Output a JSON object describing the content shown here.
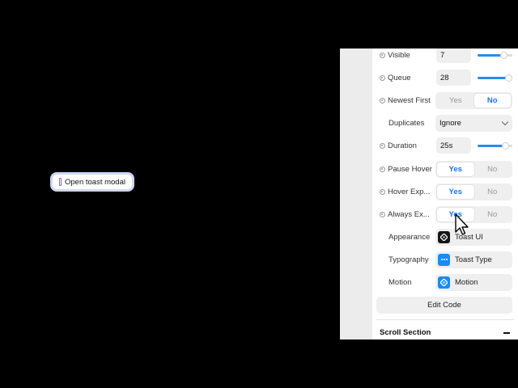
{
  "canvas": {
    "open_button_label": "Open toast modal"
  },
  "panel": {
    "rows": {
      "visible": {
        "label": "Visible",
        "value": "7",
        "slider_fraction": 0.75
      },
      "queue": {
        "label": "Queue",
        "value": "28",
        "slider_fraction": 0.88
      },
      "newest_first": {
        "label": "Newest First",
        "yes": "Yes",
        "no": "No",
        "selected": "No"
      },
      "duplicates": {
        "label": "Duplicates",
        "value": "Ignore"
      },
      "duration": {
        "label": "Duration",
        "value": "25s",
        "slider_fraction": 0.78
      },
      "pause_hover": {
        "label": "Pause Hover",
        "yes": "Yes",
        "no": "No",
        "selected": "Yes"
      },
      "hover_expand": {
        "label": "Hover Exp...",
        "yes": "Yes",
        "no": "No",
        "selected": "Yes"
      },
      "always_expand": {
        "label": "Always Ex...",
        "yes": "Yes",
        "no": "No",
        "selected": "Yes"
      },
      "appearance": {
        "label": "Appearance",
        "value": "Toast UI",
        "icon": "diamond-icon"
      },
      "typography": {
        "label": "Typography",
        "value": "Toast Type",
        "icon": "ellipsis-icon"
      },
      "motion": {
        "label": "Motion",
        "value": "Motion",
        "icon": "diamond-icon"
      }
    },
    "edit_code_label": "Edit Code",
    "section_title": "Scroll Section"
  },
  "colors": {
    "accent": "#1a73e8",
    "slider": "#2d8bea",
    "background": "#000000"
  }
}
